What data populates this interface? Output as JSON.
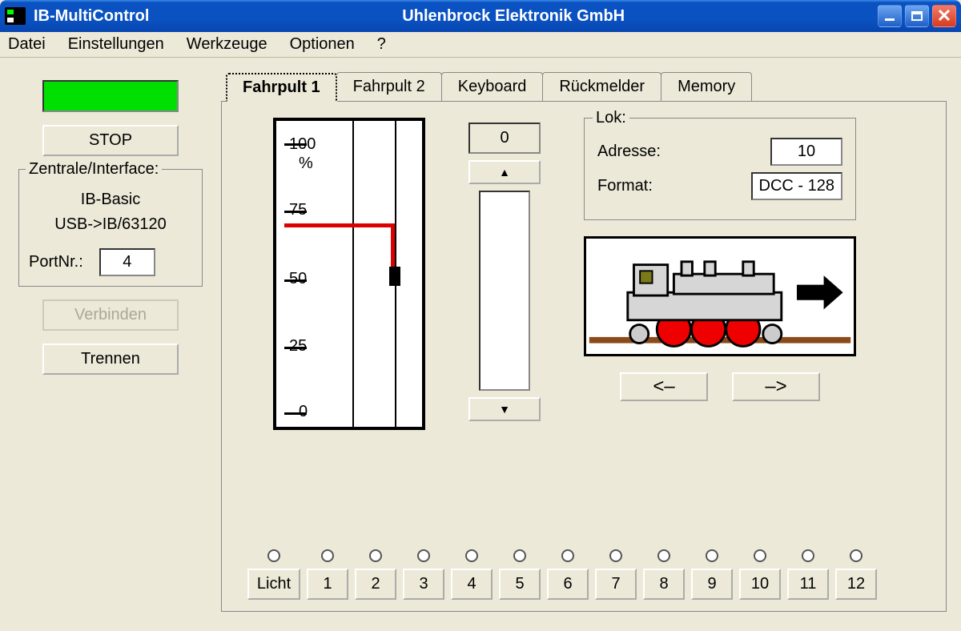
{
  "titlebar": {
    "app_title": "IB-MultiControl",
    "company": "Uhlenbrock Elektronik GmbH"
  },
  "menu": {
    "datei": "Datei",
    "einstellungen": "Einstellungen",
    "werkzeuge": "Werkzeuge",
    "optionen": "Optionen",
    "help": "?"
  },
  "left": {
    "stop": "STOP",
    "zentrale_legend": "Zentrale/Interface:",
    "device": "IB-Basic",
    "conn": "USB->IB/63120",
    "port_label": "PortNr.:",
    "port_value": "4",
    "verbinden": "Verbinden",
    "trennen": "Trennen"
  },
  "tabs": {
    "t1": "Fahrpult 1",
    "t2": "Fahrpult 2",
    "t3": "Keyboard",
    "t4": "Rückmelder",
    "t5": "Memory"
  },
  "gauge": {
    "l100": "100",
    "pct": "%",
    "l75": "75",
    "l50": "50",
    "l25": "25",
    "l0": "0"
  },
  "spinner": {
    "value": "0",
    "up": "▲",
    "down": "▼"
  },
  "lok": {
    "legend": "Lok:",
    "addr_label": "Adresse:",
    "addr_value": "10",
    "fmt_label": "Format:",
    "fmt_value": "DCC - 128",
    "left": "<–",
    "right": "–>"
  },
  "fn": {
    "licht": "Licht",
    "b1": "1",
    "b2": "2",
    "b3": "3",
    "b4": "4",
    "b5": "5",
    "b6": "6",
    "b7": "7",
    "b8": "8",
    "b9": "9",
    "b10": "10",
    "b11": "11",
    "b12": "12"
  }
}
